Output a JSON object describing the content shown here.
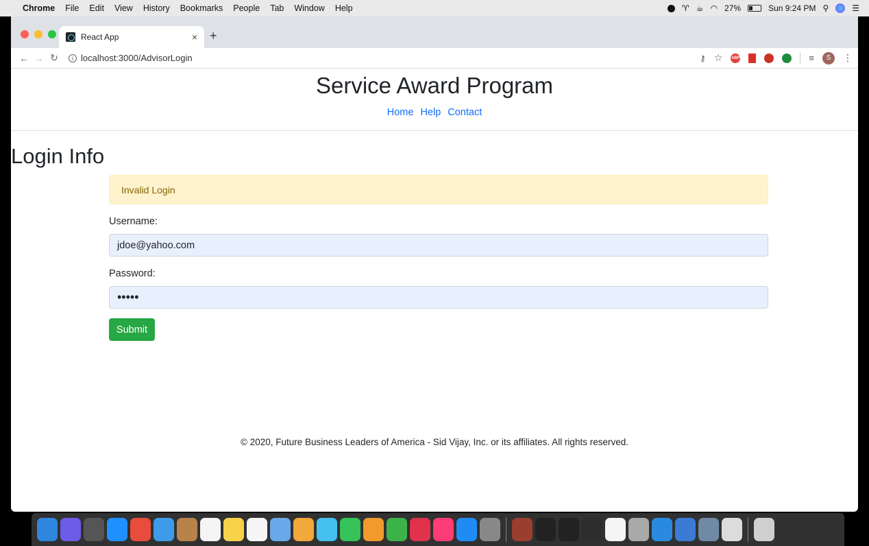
{
  "menubar": {
    "apple": "",
    "app_name": "Chrome",
    "items": [
      "File",
      "Edit",
      "View",
      "History",
      "Bookmarks",
      "People",
      "Tab",
      "Window",
      "Help"
    ],
    "battery": "27%",
    "clock": "Sun 9:24 PM"
  },
  "browser": {
    "tab_title": "React App",
    "tab_close": "×",
    "new_tab": "+",
    "url": "localhost:3000/AdvisorLogin",
    "avatar_initial": "S",
    "abp_label": "ABP"
  },
  "site": {
    "title": "Service Award Program",
    "nav": [
      "Home",
      "Help",
      "Contact"
    ]
  },
  "login": {
    "heading": "Login Info",
    "alert": "Invalid Login",
    "username_label": "Username:",
    "username_value": "jdoe@yahoo.com",
    "password_label": "Password:",
    "password_value": "•••••",
    "submit_label": "Submit"
  },
  "footer": {
    "text": "© 2020, Future Business Leaders of America - Sid Vijay, Inc. or its affiliates. All rights reserved."
  },
  "dock": {
    "apps": [
      "finder",
      "siri",
      "launchpad",
      "safari",
      "chrome",
      "mail",
      "contacts",
      "calendar",
      "notes",
      "reminders",
      "preview",
      "photos",
      "messages",
      "facetime",
      "pages",
      "numbers",
      "news",
      "music",
      "app-store",
      "system-preferences",
      "dictionary",
      "terminal",
      "intellij",
      "activity-monitor",
      "textedit",
      "keychain",
      "vscode",
      "quicktime",
      "image-capture",
      "screen",
      "trash"
    ],
    "colors": [
      "#2e86de",
      "#6c5ce7",
      "#555",
      "#1e90ff",
      "#e74c3c",
      "#3d9be9",
      "#b8824a",
      "#f5f5f5",
      "#f7d34a",
      "#f5f5f5",
      "#6aa9e9",
      "#f3a83b",
      "#45c1f0",
      "#36c35a",
      "#f19a2e",
      "#3cb34a",
      "#e0324b",
      "#fc3c74",
      "#1f8cf5",
      "#888",
      "#9b3d2f",
      "#222",
      "#222",
      "#2d2d2d",
      "#f5f5f5",
      "#a9a9a9",
      "#2a8ae0",
      "#3a7bd5",
      "#6f8aa5",
      "#dcdcdc",
      "#cfcfcf"
    ]
  }
}
